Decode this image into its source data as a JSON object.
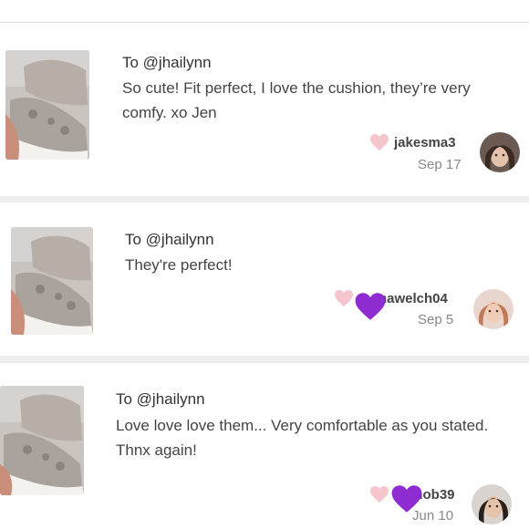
{
  "comments": [
    {
      "to": "To @jhailynn",
      "text": "So cute! Fit perfect, I love the cushion, they’re very comfy. xo Jen",
      "username": "jakesma3",
      "date": "Sep 17"
    },
    {
      "to": "To @jhailynn",
      "text": "They're perfect!",
      "username": "nawelch04",
      "date": "Sep 5"
    },
    {
      "to": "To @jhailynn",
      "text": "Love love love them... Very comfortable as you stated. Thnx again!",
      "username": "jmob39",
      "date": "Jun 10"
    }
  ],
  "icons": {
    "like": "heart-outline-icon",
    "reaction": "purple-heart-emoji-icon",
    "product": "snakeskin-sneaker-photo"
  },
  "colors": {
    "like_heart": "#f6c6cf",
    "purple_heart": "#8e2bd1",
    "muted_text": "#888888"
  }
}
